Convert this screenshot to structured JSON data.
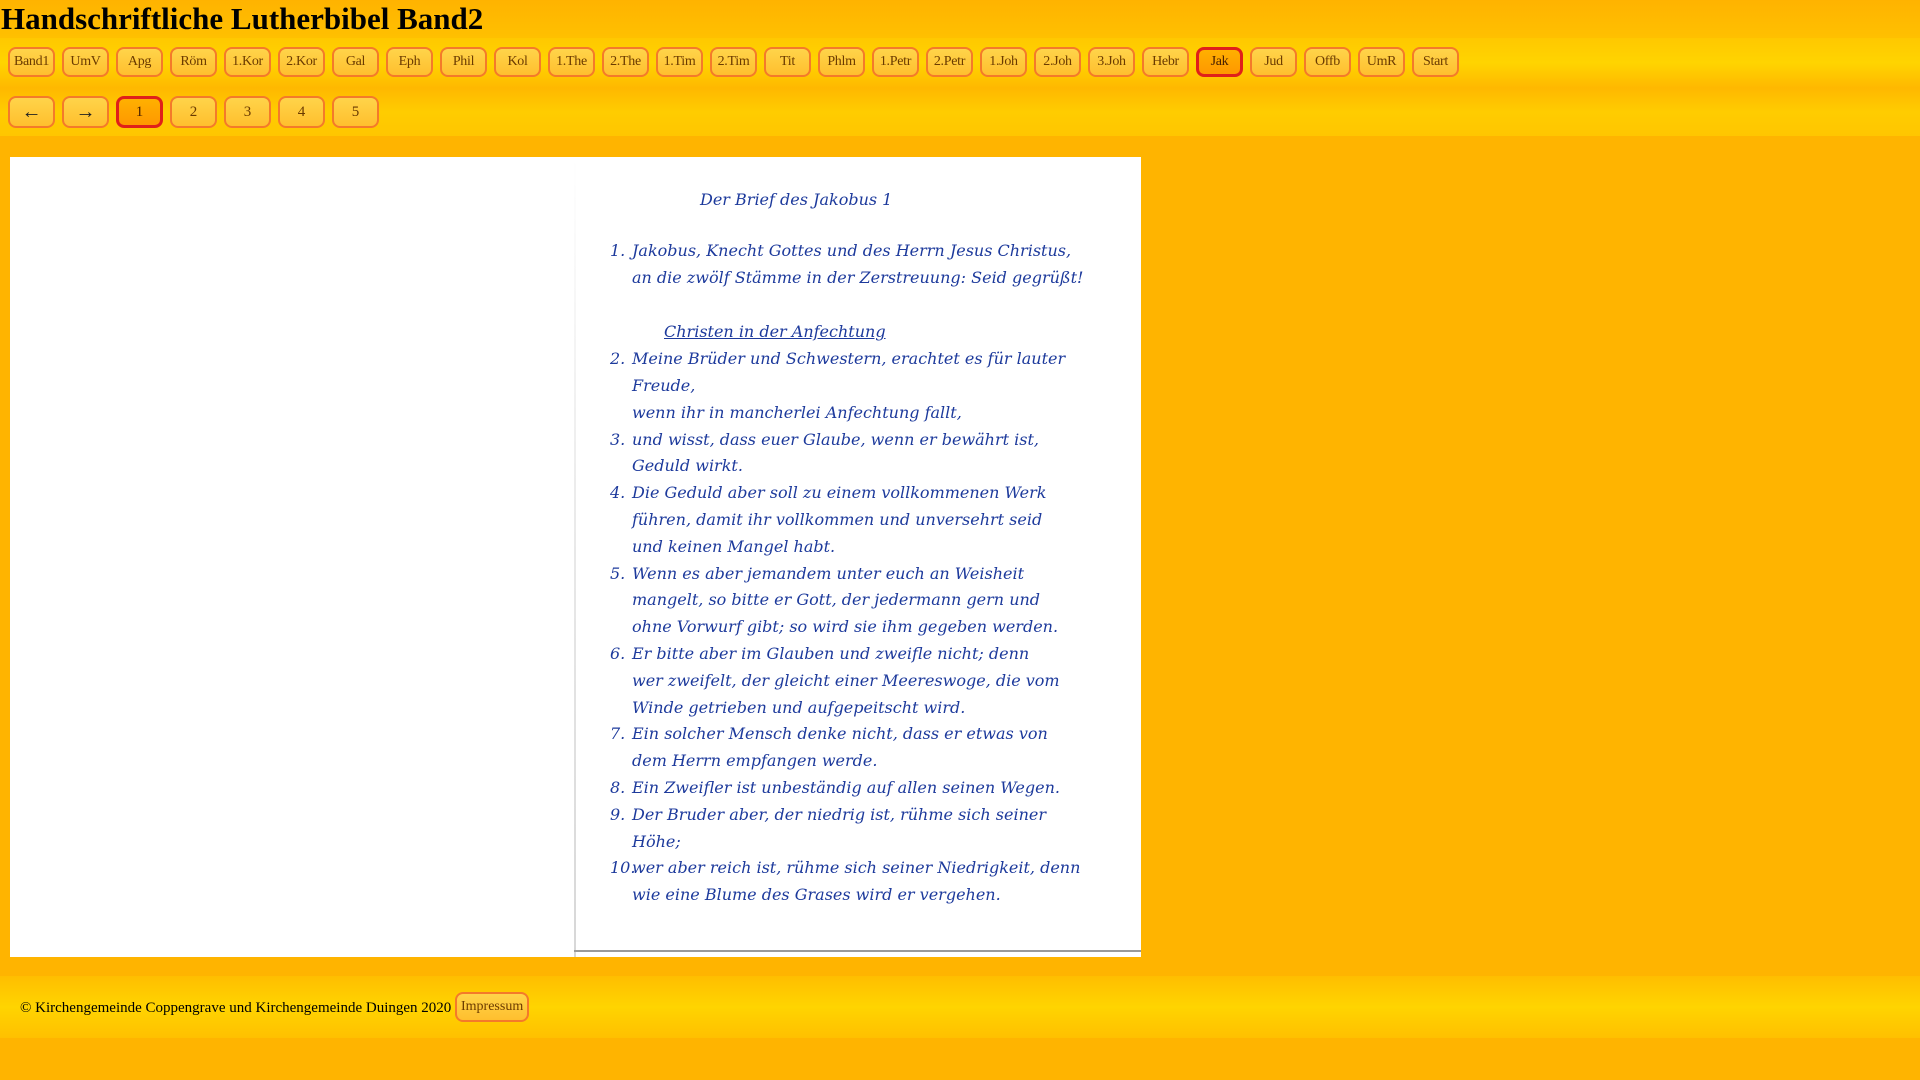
{
  "site_title": "Handschriftliche Lutherbibel Band2",
  "books": [
    "Band1",
    "UmV",
    "Apg",
    "Röm",
    "1.Kor",
    "2.Kor",
    "Gal",
    "Eph",
    "Phil",
    "Kol",
    "1.The",
    "2.The",
    "1.Tim",
    "2.Tim",
    "Tit",
    "Phlm",
    "1.Petr",
    "2.Petr",
    "1.Joh",
    "2.Joh",
    "3.Joh",
    "Hebr",
    "Jak",
    "Jud",
    "Offb",
    "UmR",
    "Start"
  ],
  "active_book": "Jak",
  "pager": {
    "prev": "←",
    "next": "→",
    "pages": [
      "1",
      "2",
      "3",
      "4",
      "5"
    ],
    "active_page": "1"
  },
  "manuscript": {
    "heading": "Der Brief des Jakobus 1",
    "verse1": {
      "num": "1.",
      "lines": [
        "Jakobus, Knecht Gottes und des Herrn Jesus Christus,",
        "an die zwölf Stämme in der Zerstreuung: Seid gegrüßt!"
      ]
    },
    "section": "Christen in der Anfechtung",
    "verses": [
      {
        "num": "2.",
        "lines": [
          "Meine Brüder und Schwestern, erachtet es für lauter Freude,",
          "wenn ihr in mancherlei Anfechtung fallt,"
        ]
      },
      {
        "num": "3.",
        "lines": [
          "und wisst, dass euer Glaube, wenn er bewährt ist,",
          "Geduld wirkt."
        ]
      },
      {
        "num": "4.",
        "lines": [
          "Die Geduld aber soll zu einem vollkommenen Werk",
          "führen, damit ihr vollkommen und unversehrt seid",
          "und keinen Mangel habt."
        ]
      },
      {
        "num": "5.",
        "lines": [
          "Wenn es aber jemandem unter euch an Weisheit",
          "mangelt, so bitte er Gott, der jedermann gern und",
          "ohne Vorwurf gibt; so wird sie ihm gegeben werden."
        ]
      },
      {
        "num": "6.",
        "lines": [
          "Er bitte aber im Glauben und zweifle nicht; denn",
          "wer zweifelt, der gleicht einer Meereswoge, die vom",
          "Winde getrieben und aufgepeitscht wird."
        ]
      },
      {
        "num": "7.",
        "lines": [
          "Ein solcher Mensch denke nicht, dass er etwas von",
          "dem Herrn empfangen werde."
        ]
      },
      {
        "num": "8.",
        "lines": [
          "Ein Zweifler ist unbeständig auf allen seinen Wegen."
        ]
      },
      {
        "num": "9.",
        "lines": [
          "Der Bruder aber, der niedrig ist, rühme sich seiner",
          "Höhe;"
        ]
      },
      {
        "num": "10.",
        "lines": [
          "wer aber reich ist, rühme sich seiner Niedrigkeit, denn",
          "wie eine Blume des Grases wird er vergehen."
        ]
      }
    ]
  },
  "footer": {
    "copyright": "© Kirchengemeinde Coppengrave und Kirchengemeinde Duingen 2020",
    "impressum": "Impressum"
  }
}
